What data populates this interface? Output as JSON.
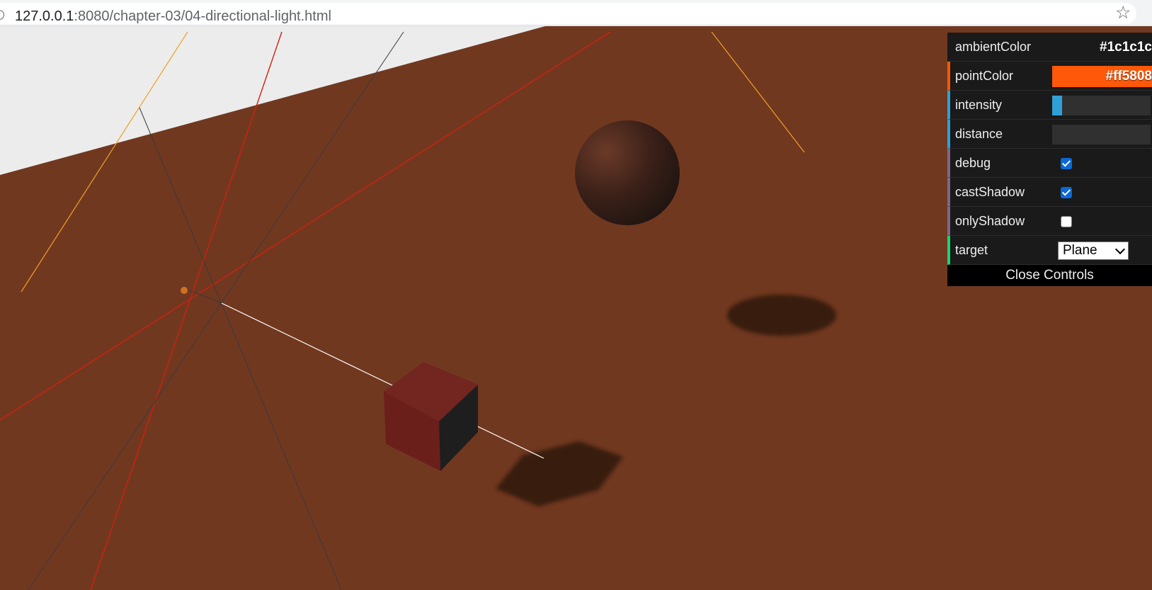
{
  "browser": {
    "url_host": "127.0.0.1",
    "url_rest": ":8080/chapter-03/04-directional-light.html",
    "site_icon": "info-circle-icon",
    "bookmark_icon": "star-icon"
  },
  "scene": {
    "background_color": "#ececec",
    "ground_color": "#713820",
    "shadow_color": "#371a10",
    "cube_color": "#6b1f1a",
    "sphere_color": "#4a2a1f"
  },
  "controls": {
    "ambient": {
      "label": "ambientColor",
      "value": "#1c1c1c"
    },
    "point": {
      "label": "pointColor",
      "value": "#ff5808"
    },
    "intensity": {
      "label": "intensity",
      "value": 0.1
    },
    "distance": {
      "label": "distance",
      "value": 0
    },
    "debug": {
      "label": "debug",
      "checked": true
    },
    "castShadow": {
      "label": "castShadow",
      "checked": true
    },
    "onlyShadow": {
      "label": "onlyShadow",
      "checked": false
    },
    "target": {
      "label": "target",
      "selected": "Plane"
    },
    "close_label": "Close Controls"
  }
}
